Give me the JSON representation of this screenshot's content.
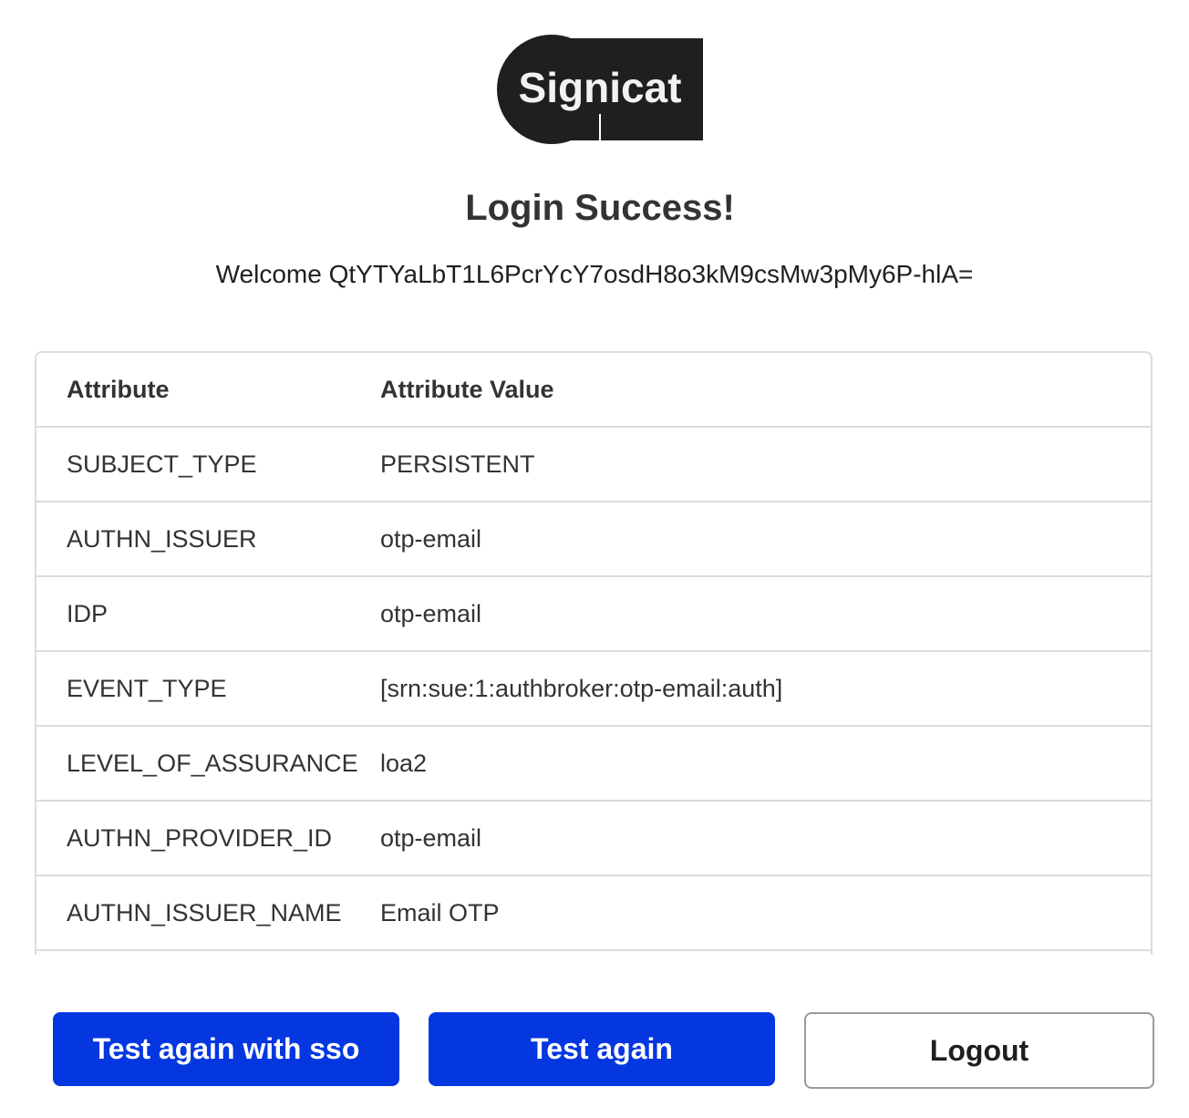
{
  "logo": {
    "text": "Signicat"
  },
  "heading": "Login Success!",
  "welcome": "Welcome QtYTYaLbT1L6PcrYcY7osdH8o3kM9csMw3pMy6P-hlA=",
  "table": {
    "headers": [
      "Attribute",
      "Attribute Value"
    ],
    "rows": [
      {
        "attribute": "SUBJECT_TYPE",
        "value": "PERSISTENT"
      },
      {
        "attribute": "AUTHN_ISSUER",
        "value": "otp-email"
      },
      {
        "attribute": "IDP",
        "value": "otp-email"
      },
      {
        "attribute": "EVENT_TYPE",
        "value": "[srn:sue:1:authbroker:otp-email:auth]"
      },
      {
        "attribute": "LEVEL_OF_ASSURANCE",
        "value": "loa2"
      },
      {
        "attribute": "AUTHN_PROVIDER_ID",
        "value": "otp-email"
      },
      {
        "attribute": "AUTHN_ISSUER_NAME",
        "value": "Email OTP"
      }
    ]
  },
  "buttons": {
    "test_again_sso": "Test again with sso",
    "test_again": "Test again",
    "logout": "Logout"
  },
  "colors": {
    "primary": "#0437e0",
    "logo": "#1f1f1f",
    "border": "#dcdcdc"
  }
}
